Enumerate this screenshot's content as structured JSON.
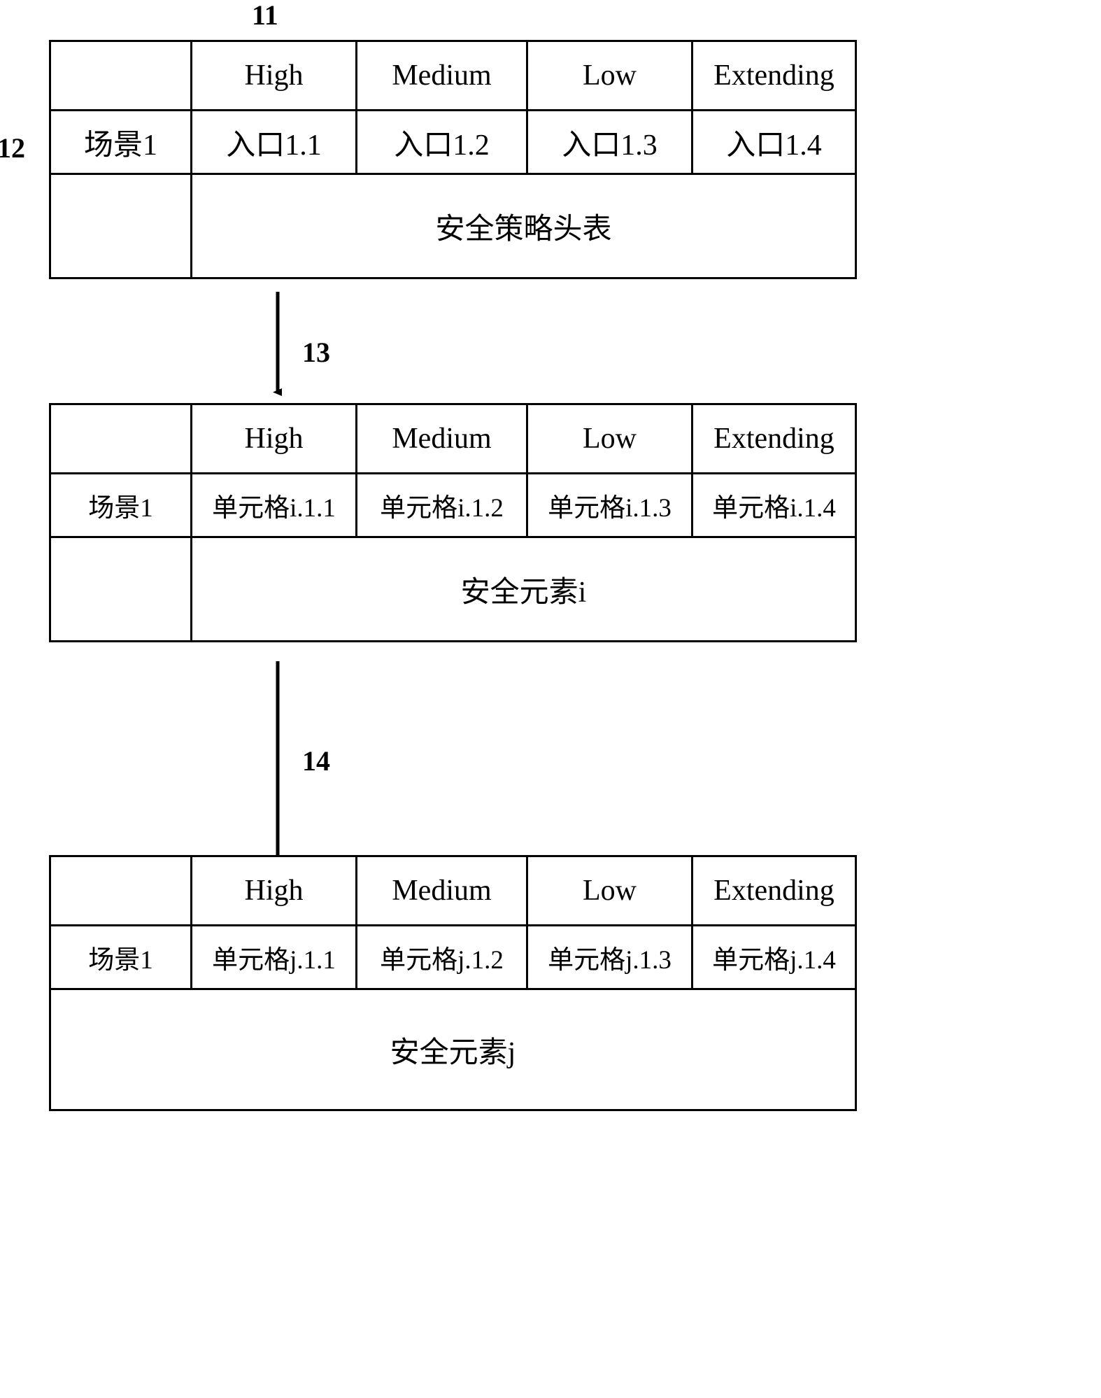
{
  "figure": {
    "refs": {
      "policy_head_table": "11",
      "scene_row": "12",
      "security_element_i": "13",
      "security_element_j": "14"
    }
  },
  "columns": [
    "",
    "High",
    "Medium",
    "Low",
    "Extending"
  ],
  "tables": [
    {
      "ref": "11",
      "header": [
        "",
        "High",
        "Medium",
        "Low",
        "Extending"
      ],
      "row": [
        "场景1",
        "入口1.1",
        "入口1.2",
        "入口1.3",
        "入口1.4"
      ],
      "caption": "安全策略头表"
    },
    {
      "ref": "13",
      "header": [
        "",
        "High",
        "Medium",
        "Low",
        "Extending"
      ],
      "row": [
        "场景1",
        "单元格i.1.1",
        "单元格i.1.2",
        "单元格i.1.3",
        "单元格i.1.4"
      ],
      "caption": "安全元素i"
    },
    {
      "ref": "14",
      "header": [
        "",
        "High",
        "Medium",
        "Low",
        "Extending"
      ],
      "row": [
        "场景1",
        "单元格j.1.1",
        "单元格j.1.2",
        "单元格j.1.3",
        "单元格j.1.4"
      ],
      "caption": "安全元素j"
    }
  ],
  "connectors": [
    {
      "label": "13",
      "from": "安全策略头表",
      "to": "安全元素i"
    },
    {
      "label": "14",
      "from": "安全元素i",
      "to": "安全元素j"
    }
  ],
  "style": {
    "line_color": "#000000",
    "background": "#ffffff"
  }
}
